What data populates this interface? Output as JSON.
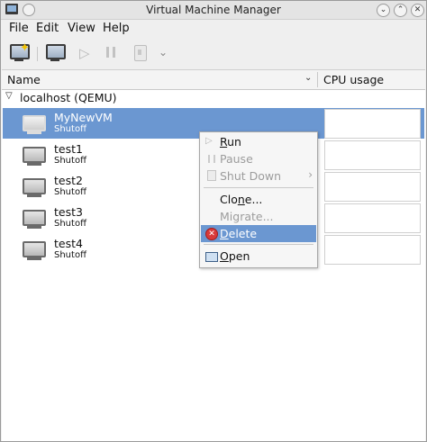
{
  "window": {
    "title": "Virtual Machine Manager"
  },
  "menubar": [
    "File",
    "Edit",
    "View",
    "Help"
  ],
  "toolbar": {
    "icons": [
      "new-vm-icon",
      "open-console-icon",
      "run-icon",
      "pause-icon",
      "shutdown-icon",
      "chevron-down-icon"
    ]
  },
  "list": {
    "columns": [
      "Name",
      "CPU usage"
    ],
    "group": "localhost (QEMU)",
    "vms": [
      {
        "name": "MyNewVM",
        "status": "Shutoff"
      },
      {
        "name": "test1",
        "status": "Shutoff"
      },
      {
        "name": "test2",
        "status": "Shutoff"
      },
      {
        "name": "test3",
        "status": "Shutoff"
      },
      {
        "name": "test4",
        "status": "Shutoff"
      }
    ]
  },
  "context_menu": {
    "run": {
      "prefix": "",
      "underlined": "R",
      "rest": "un"
    },
    "pause": "Pause",
    "shutdown": "Shut Down",
    "clone": {
      "prefix": "Clo",
      "underlined": "n",
      "rest": "e..."
    },
    "migrate": "Migrate...",
    "delete": {
      "prefix": "",
      "underlined": "D",
      "rest": "elete"
    },
    "open": {
      "prefix": "",
      "underlined": "O",
      "rest": "pen"
    }
  },
  "colors": {
    "selection": "#6b97d1",
    "delete_icon": "#d83a3a"
  }
}
